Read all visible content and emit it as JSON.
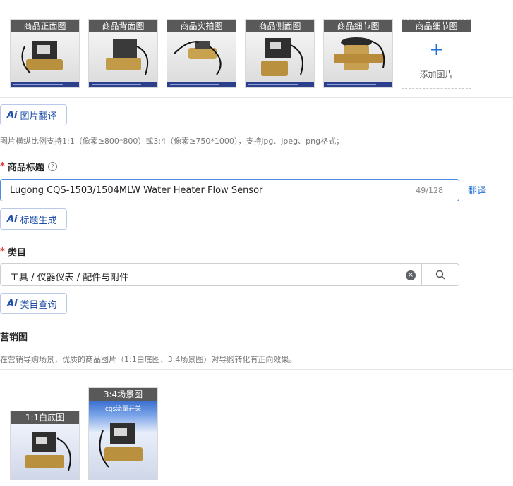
{
  "main_images": {
    "tiles": [
      {
        "label": "商品正面图"
      },
      {
        "label": "商品背面图"
      },
      {
        "label": "商品实拍图"
      },
      {
        "label": "商品侧面图"
      },
      {
        "label": "商品细节图"
      }
    ],
    "add_tile": {
      "label": "商品细节图",
      "plus": "+",
      "text": "添加图片"
    }
  },
  "image_translate_button": {
    "ai": "Ai",
    "label": "图片翻译"
  },
  "image_hint": "图片横纵比例支持1:1（像素≥800*800）或3:4（像素≥750*1000），支持jpg、jpeg、png格式；",
  "title_field": {
    "required_mark": "*",
    "label": "商品标题",
    "help": "?",
    "value": "Lugong CQS-1503/1504MLW Water Heater Flow Sensor",
    "count": "49/128",
    "translate_link": "翻译"
  },
  "title_generate_button": {
    "ai": "Ai",
    "label": "标题生成"
  },
  "category_field": {
    "required_mark": "*",
    "label": "类目",
    "value": "工具 / 仪器仪表 / 配件与附件",
    "clear_icon": "×"
  },
  "category_query_button": {
    "ai": "Ai",
    "label": "类目查询"
  },
  "marketing": {
    "label": "营销图",
    "hint": "在营销导购场景，优质的商品图片（1:1白底图、3:4场景图）对导购转化有正向效果。",
    "tiles": [
      {
        "label": "1:1白底图"
      },
      {
        "label": "3:4场景图",
        "banner_text": "cqs流量开关"
      }
    ]
  },
  "colors": {
    "accent": "#1f6fd6",
    "required": "#e4393c",
    "tile_label_bg": "#595959"
  }
}
